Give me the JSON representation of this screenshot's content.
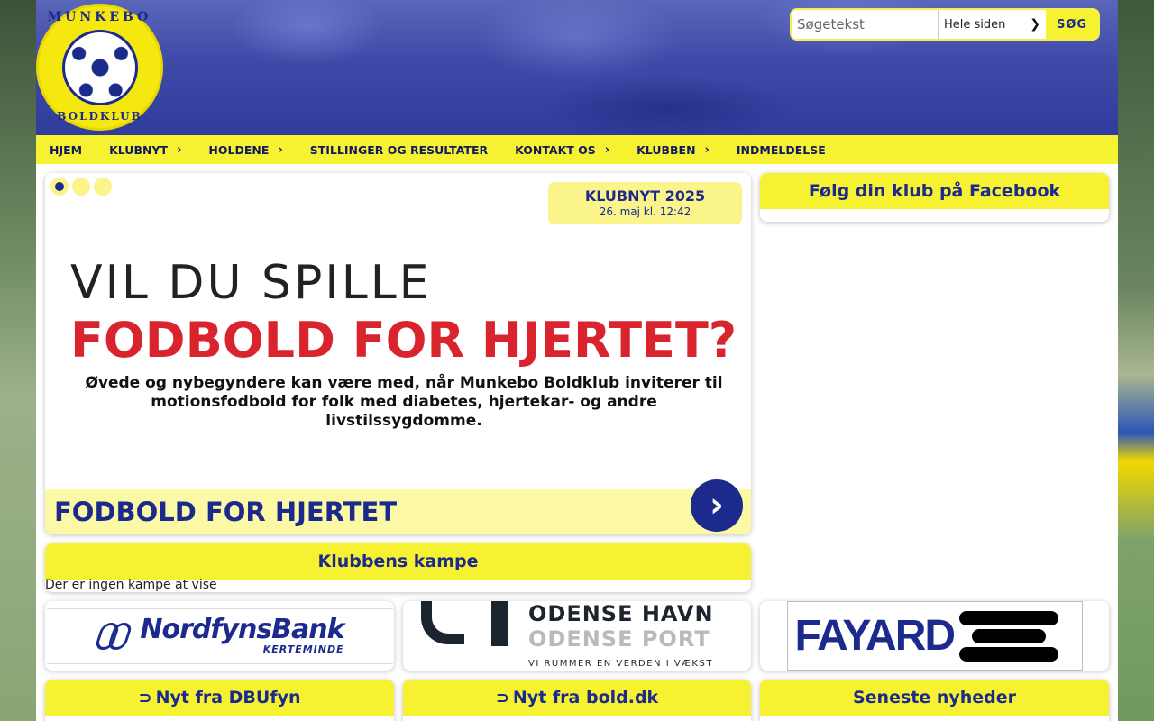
{
  "search": {
    "placeholder": "Søgetekst",
    "scope": "Hele siden",
    "button": "SØG"
  },
  "logo": {
    "top_text": "MUNKEBO",
    "bottom_text": "BOLDKLUB"
  },
  "nav": {
    "items": [
      {
        "label": "HJEM",
        "has_submenu": false
      },
      {
        "label": "KLUBNYT",
        "has_submenu": true
      },
      {
        "label": "HOLDENE",
        "has_submenu": true
      },
      {
        "label": "STILLINGER OG RESULTATER",
        "has_submenu": false
      },
      {
        "label": "KONTAKT OS",
        "has_submenu": true
      },
      {
        "label": "KLUBBEN",
        "has_submenu": true
      },
      {
        "label": "INDMELDELSE",
        "has_submenu": false
      }
    ]
  },
  "slider": {
    "category": "KLUBNYT 2025",
    "date": "26. maj kl. 12:42",
    "image_line1": "VIL DU SPILLE",
    "image_line2": "FODBOLD FOR HJERTET?",
    "image_line3": "Øvede og nybegyndere kan være med, når Munkebo Boldklub inviterer til motionsfodbold for folk med diabetes, hjertekar- og andre livstilssygdomme.",
    "title": "FODBOLD FOR HJERTET",
    "slide_count": 3,
    "active_slide": 1
  },
  "facebook": {
    "title": "Følg din klub på Facebook"
  },
  "matches": {
    "title": "Klubbens kampe",
    "empty_text": "Der er ingen kampe at vise"
  },
  "sponsors": {
    "nordfyns": {
      "name": "NordfynsBank",
      "sub": "KERTEMINDE"
    },
    "odense": {
      "line1": "ODENSE HAVN",
      "line2": "ODENSE PORT",
      "tagline": "VI RUMMER EN VERDEN I VÆKST"
    },
    "fayard": {
      "name": "FAYARD"
    }
  },
  "feeds": {
    "dbu": "Nyt fra DBUfyn",
    "bold": "Nyt fra bold.dk",
    "latest": "Seneste nyheder"
  },
  "colors": {
    "yellow": "#f7f231",
    "navy": "#1b2a8c",
    "light_yellow": "#fcf9a6",
    "promo_red": "#d9242e"
  }
}
